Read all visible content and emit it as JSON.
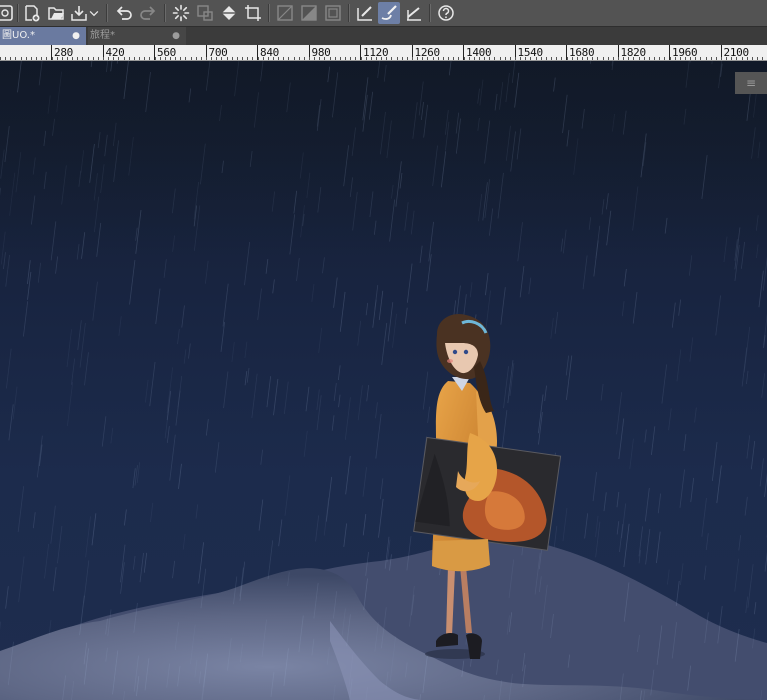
{
  "toolbar": {
    "icons": [
      "app-icon",
      "new-file-icon",
      "open-file-icon",
      "save-file-icon",
      "chevron-down-icon",
      "undo-icon",
      "redo-icon",
      "loading-spinner-icon",
      "clear-selection-icon",
      "fill-icon",
      "crop-icon",
      "transparent-icon",
      "gradient-square-icon",
      "frame-icon",
      "pen-tool-icon",
      "brush-tool-icon",
      "line-ruler-icon",
      "help-icon"
    ]
  },
  "tabs": [
    {
      "label": "圖UO.*",
      "close": "●"
    },
    {
      "label": "旅程*",
      "close": "●"
    }
  ],
  "ruler": {
    "labels": [
      "280",
      "420",
      "560",
      "700",
      "840",
      "980",
      "1120",
      "1260",
      "1400",
      "1540",
      "1680",
      "1820",
      "1960",
      "2100"
    ]
  },
  "side_panel": {
    "menu_icon": "≡"
  },
  "colors": {
    "toolbar_bg": "#535353",
    "active_accent": "#6a7aa0",
    "sky": "#1c2b4c",
    "cloud": "#6a7390",
    "coat": "#d28a2c"
  }
}
